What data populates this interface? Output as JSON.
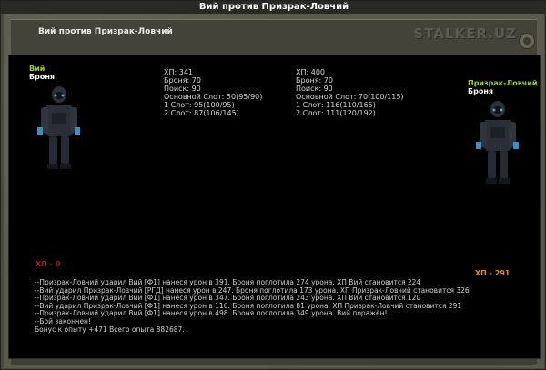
{
  "window": {
    "title": "Вий против Призрак-Ловчий"
  },
  "header": {
    "title": "Вий против Призрак-Ловчий",
    "logo": "STALKER.UZ"
  },
  "left": {
    "name": "Вий",
    "armor": "Броня",
    "stats": [
      "ХП: 341",
      "Броня: 70",
      "Поиск: 90",
      "Основной Слот: 50(95/90)",
      "1 Слот: 95(100/95)",
      "2 Слот: 87(106/145)"
    ],
    "hp": "ХП - 0"
  },
  "right": {
    "name": "Призрак-Ловчий",
    "armor": "Броня",
    "stats": [
      "ХП: 400",
      "Броня: 70",
      "Поиск: 90",
      "Основной Слот: 70(100/115)",
      "1 Слот: 116(110/165)",
      "2 Слот: 111(120/192)"
    ],
    "hp": "ХП - 291"
  },
  "log": [
    "--Призрак-Ловчий ударил Вий [Ф1] нанеся урон в 391. Броня поглотила 274 урона. ХП Вий становится 224",
    "--Вий ударил Призрак-Ловчий [РГД] нанеся урон в 247. Броня поглотила 173 урона. ХП Призрак-Ловчий становится 326",
    "--Призрак-Ловчий ударил Вий [Ф1] нанеся урон в 347. Броня поглотила 243 урона. ХП Вий становится 120",
    "--Вий ударил Призрак-Ловчий [Ф1] нанеся урон в 116. Броня поглотила 81 урона. ХП Призрак-Ловчий становится 291",
    "--Призрак-Ловчий ударил Вий [Ф1] нанеся урон в 498. Броня поглотила 349 урона. Вий поражён!",
    "--Бой закончен!",
    "Бонус к опыту +471 Всего опыта 882687."
  ],
  "colors": {
    "name_green": "#9acd32",
    "hp_red": "#b31b1b",
    "hp_orange": "#e38a16"
  }
}
